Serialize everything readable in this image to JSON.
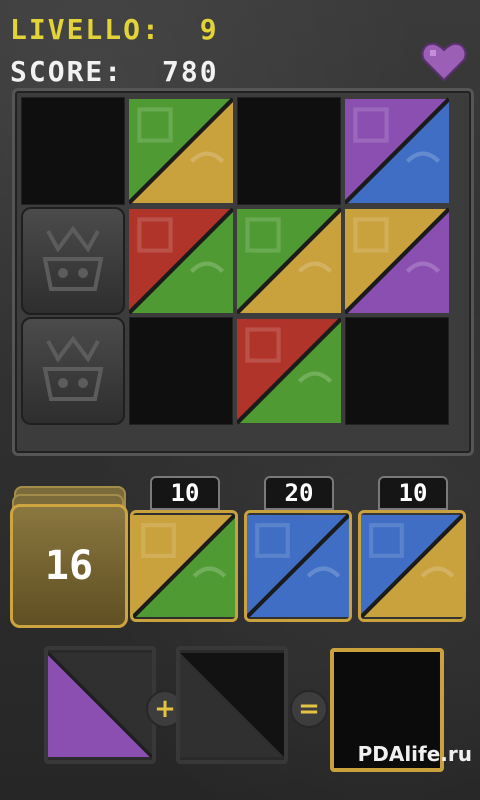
{
  "hud": {
    "level_label": "LIVELLO:",
    "level_value": "9",
    "score_label": "SCORE:",
    "score_value": "780",
    "lives_icon": "heart-icon"
  },
  "colors": {
    "gold": "#c9a13d",
    "green": "#4f9a33",
    "red": "#b0342a",
    "blue": "#3f6ec4",
    "purple": "#8a4fb1"
  },
  "board": {
    "rows": 3,
    "cols": 4,
    "cells": [
      {
        "r": 0,
        "c": 0,
        "type": "empty"
      },
      {
        "r": 0,
        "c": 1,
        "type": "tile",
        "tl": "green",
        "br": "gold"
      },
      {
        "r": 0,
        "c": 2,
        "type": "empty"
      },
      {
        "r": 0,
        "c": 3,
        "type": "tile",
        "tl": "purple",
        "br": "blue"
      },
      {
        "r": 1,
        "c": 0,
        "type": "stone"
      },
      {
        "r": 1,
        "c": 1,
        "type": "tile",
        "tl": "red",
        "br": "green"
      },
      {
        "r": 1,
        "c": 2,
        "type": "tile",
        "tl": "green",
        "br": "gold"
      },
      {
        "r": 1,
        "c": 3,
        "type": "tile",
        "tl": "gold",
        "br": "purple"
      },
      {
        "r": 2,
        "c": 0,
        "type": "stone"
      },
      {
        "r": 2,
        "c": 1,
        "type": "empty"
      },
      {
        "r": 2,
        "c": 2,
        "type": "tile",
        "tl": "red",
        "br": "green"
      },
      {
        "r": 2,
        "c": 3,
        "type": "empty"
      }
    ]
  },
  "deck": {
    "remaining": "16"
  },
  "hand": [
    {
      "points": "10",
      "tl": "gold",
      "br": "green"
    },
    {
      "points": "20",
      "tl": "blue",
      "br": "blue"
    },
    {
      "points": "10",
      "tl": "blue",
      "br": "gold"
    }
  ],
  "combine": {
    "plus": "+",
    "equals": "=",
    "slot1_color": "purple"
  },
  "watermark": "PDAlife.ru"
}
